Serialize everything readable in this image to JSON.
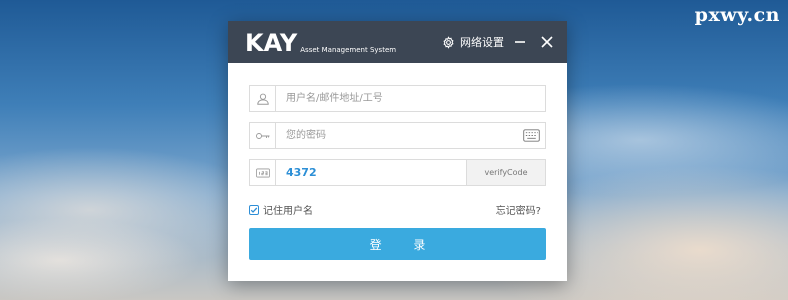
{
  "watermark": "pxwy.cn",
  "titlebar": {
    "logo_text": "KAY",
    "logo_subtitle": "Asset Management System",
    "network_settings_label": "网络设置"
  },
  "form": {
    "username_placeholder": "用户名/邮件地址/工号",
    "password_placeholder": "您的密码",
    "verify_code_value": "4372",
    "verify_code_image_label": "verifyCode",
    "remember_label": "记住用户名",
    "remember_checked": true,
    "forgot_label": "忘记密码?",
    "login_label": "登 录"
  },
  "colors": {
    "titlebar_bg": "#3c4654",
    "accent": "#3aaadf",
    "code_text": "#2c8fd6"
  }
}
